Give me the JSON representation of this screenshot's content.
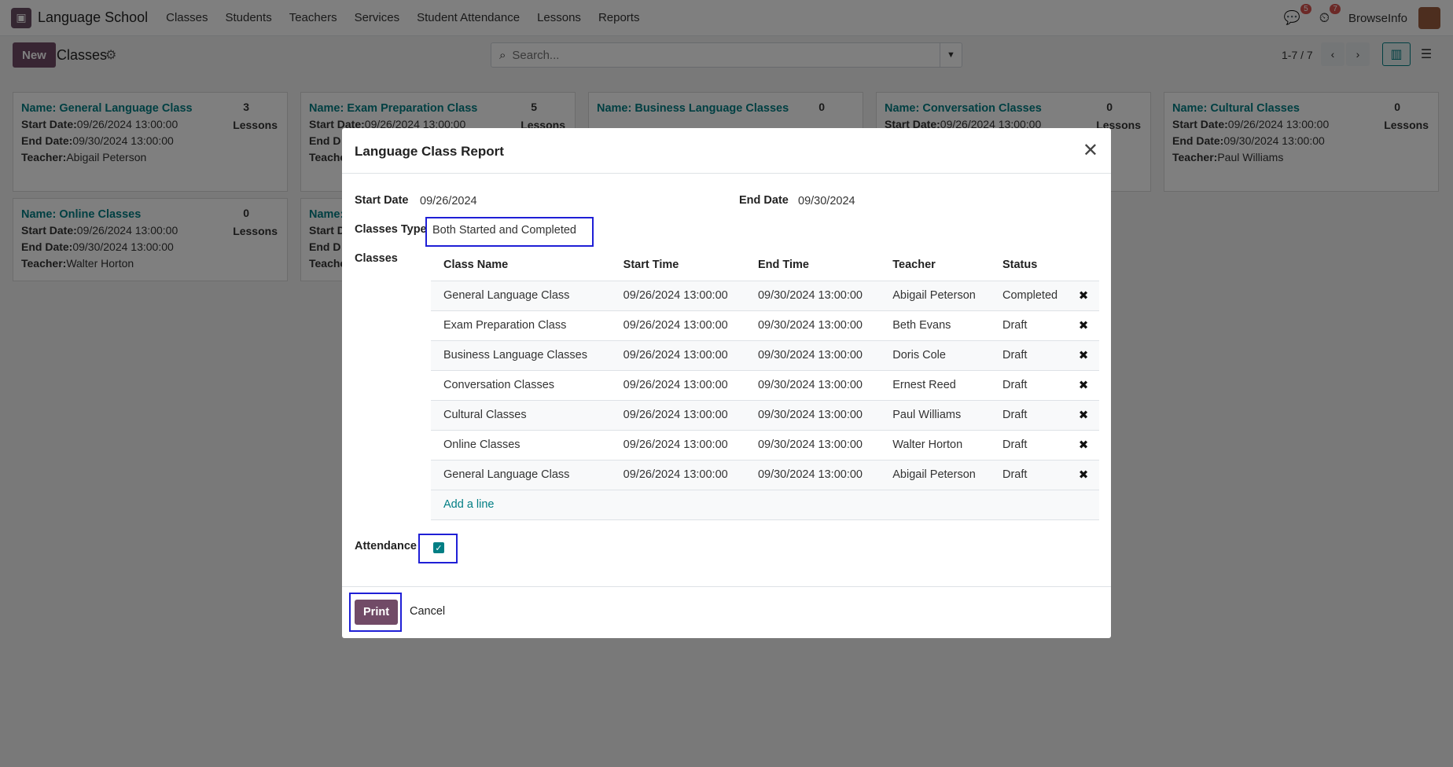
{
  "navbar": {
    "app_name": "Language School",
    "menu": [
      "Classes",
      "Students",
      "Teachers",
      "Services",
      "Student Attendance",
      "Lessons",
      "Reports"
    ],
    "messages_badge": "5",
    "activity_badge": "7",
    "user_name": "BrowseInfo"
  },
  "control": {
    "new_label": "New",
    "title": "Classes",
    "search_placeholder": "Search...",
    "pager": "1-7 / 7"
  },
  "cards": [
    {
      "name": "Name: General Language Class",
      "count": "3",
      "lessons": "Lessons",
      "start_label": "Start Date:",
      "start": "09/26/2024 13:00:00",
      "end_label": "End Date:",
      "end": "09/30/2024 13:00:00",
      "teacher_label": "Teacher:",
      "teacher": "Abigail Peterson"
    },
    {
      "name": "Name: Exam Preparation Class",
      "count": "5",
      "lessons": "Lessons",
      "start_label": "Start Date:",
      "start": "09/26/2024 13:00:00",
      "end_label": "End D",
      "end": "",
      "teacher_label": "Teache",
      "teacher": ""
    },
    {
      "name": "Name: Business Language Classes",
      "count": "0",
      "lessons": "",
      "start_label": "",
      "start": "",
      "end_label": "",
      "end": "",
      "teacher_label": "",
      "teacher": ""
    },
    {
      "name": "Name: Conversation Classes",
      "count": "0",
      "lessons": "Lessons",
      "start_label": "Start Date:",
      "start": "09/26/2024 13:00:00",
      "end_label": "",
      "end": "",
      "teacher_label": "",
      "teacher": ""
    },
    {
      "name": "Name: Cultural Classes",
      "count": "0",
      "lessons": "Lessons",
      "start_label": "Start Date:",
      "start": "09/26/2024 13:00:00",
      "end_label": "End Date:",
      "end": "09/30/2024 13:00:00",
      "teacher_label": "Teacher:",
      "teacher": "Paul Williams"
    },
    {
      "name": "Name: Online Classes",
      "count": "0",
      "lessons": "Lessons",
      "start_label": "Start Date:",
      "start": "09/26/2024 13:00:00",
      "end_label": "End Date:",
      "end": "09/30/2024 13:00:00",
      "teacher_label": "Teacher:",
      "teacher": "Walter Horton"
    },
    {
      "name": "Name:",
      "count": "",
      "lessons": "",
      "start_label": "Start D",
      "start": "",
      "end_label": "End D",
      "end": "",
      "teacher_label": "Teache",
      "teacher": ""
    }
  ],
  "modal": {
    "title": "Language Class Report",
    "start_date_label": "Start Date",
    "start_date": "09/26/2024",
    "end_date_label": "End Date",
    "end_date": "09/30/2024",
    "classes_type_label": "Classes Type",
    "classes_type": "Both Started and Completed",
    "classes_label": "Classes",
    "columns": [
      "Class Name",
      "Start Time",
      "End Time",
      "Teacher",
      "Status"
    ],
    "rows": [
      [
        "General Language Class",
        "09/26/2024 13:00:00",
        "09/30/2024 13:00:00",
        "Abigail Peterson",
        "Completed"
      ],
      [
        "Exam Preparation Class",
        "09/26/2024 13:00:00",
        "09/30/2024 13:00:00",
        "Beth Evans",
        "Draft"
      ],
      [
        "Business Language Classes",
        "09/26/2024 13:00:00",
        "09/30/2024 13:00:00",
        "Doris Cole",
        "Draft"
      ],
      [
        "Conversation Classes",
        "09/26/2024 13:00:00",
        "09/30/2024 13:00:00",
        "Ernest Reed",
        "Draft"
      ],
      [
        "Cultural Classes",
        "09/26/2024 13:00:00",
        "09/30/2024 13:00:00",
        "Paul Williams",
        "Draft"
      ],
      [
        "Online Classes",
        "09/26/2024 13:00:00",
        "09/30/2024 13:00:00",
        "Walter Horton",
        "Draft"
      ],
      [
        "General Language Class",
        "09/26/2024 13:00:00",
        "09/30/2024 13:00:00",
        "Abigail Peterson",
        "Draft"
      ]
    ],
    "add_line": "Add a line",
    "attendance_label": "Attendance",
    "attendance_checked": true,
    "print_label": "Print",
    "cancel_label": "Cancel"
  },
  "colors": {
    "brand": "#714b67",
    "accent": "#017e84",
    "highlight": "#1f1fd6"
  }
}
